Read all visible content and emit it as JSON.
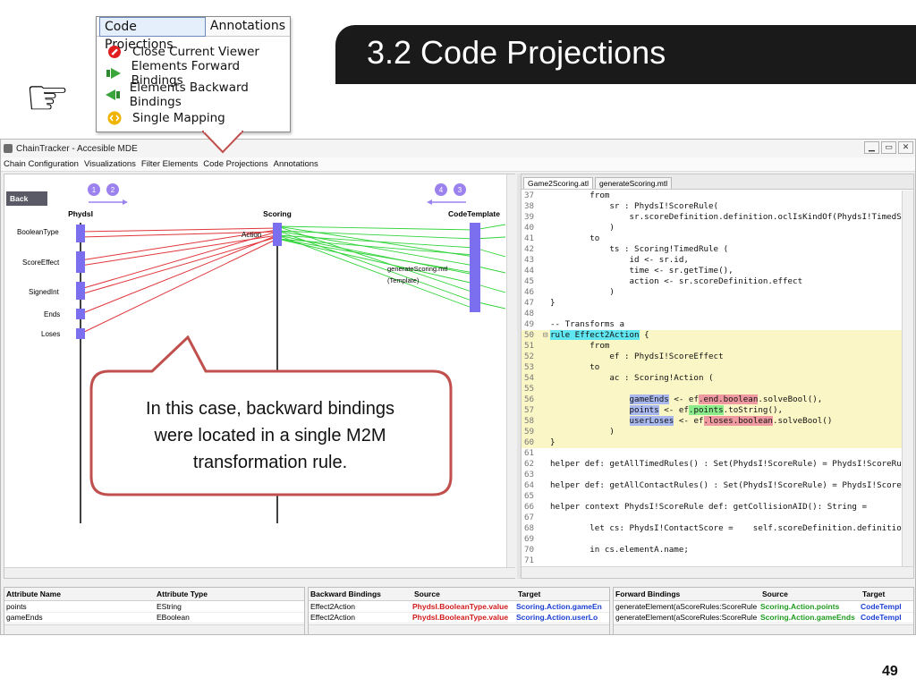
{
  "slide": {
    "title": "3.2 Code Projections",
    "page_number": "49",
    "hand_glyph": "☞"
  },
  "menu_popup": {
    "tabs": [
      "Code Projections",
      "Annotations"
    ],
    "items": [
      {
        "label": "Close Current Viewer",
        "icon": "stop-icon",
        "color": "#e02020"
      },
      {
        "label": "Elements Forward Bindings",
        "icon": "arrow-right-icon",
        "color": "#3aa53a"
      },
      {
        "label": "Elements Backward Bindings",
        "icon": "arrow-left-icon",
        "color": "#3aa53a"
      },
      {
        "label": "Single Mapping",
        "icon": "code-icon",
        "color": "#f0b400"
      }
    ]
  },
  "window": {
    "title": "ChainTracker - Accesible MDE",
    "controls": [
      "▁",
      "▭",
      "✕"
    ],
    "menu": [
      "Chain Configuration",
      "Visualizations",
      "Filter Elements",
      "Code Projections",
      "Annotations"
    ]
  },
  "viz": {
    "back_label": "Back",
    "badges_left": [
      "1",
      "2"
    ],
    "badges_right": [
      "4",
      "3"
    ],
    "columns": [
      "PhydsI",
      "Scoring",
      "CodeTemplate"
    ],
    "left_items": [
      "BooleanType",
      "ScoreEffect",
      "SignedInt",
      "Ends",
      "Loses"
    ],
    "mid_label": "Action",
    "template_label_1": "generateScoring.mtl",
    "template_label_2": "(Template)",
    "colors": {
      "backward": "#e0353a",
      "forward": "#31d43a",
      "node": "#7b6ff0",
      "badge": "#9b82ee"
    }
  },
  "callout": {
    "lines": [
      "In this case, backward bindings",
      "were located in a single M2M",
      "transformation rule."
    ],
    "border_color": "#c0504d"
  },
  "editor": {
    "tabs": [
      "Game2Scoring.atl",
      "generateScoring.mtl"
    ],
    "lines": [
      {
        "n": "37",
        "text": "        from"
      },
      {
        "n": "38",
        "text": "            sr : PhydsI!ScoreRule("
      },
      {
        "n": "39",
        "text": "                sr.scoreDefinition.definition.oclIsKindOf(PhydsI!TimedScore)"
      },
      {
        "n": "40",
        "text": "            )"
      },
      {
        "n": "41",
        "text": "        to"
      },
      {
        "n": "42",
        "text": "            ts : Scoring!TimedRule ("
      },
      {
        "n": "43",
        "text": "                id <- sr.id,"
      },
      {
        "n": "44",
        "text": "                time <- sr.getTime(),"
      },
      {
        "n": "45",
        "text": "                action <- sr.scoreDefinition.effect"
      },
      {
        "n": "46",
        "text": "            )"
      },
      {
        "n": "47",
        "text": "}"
      },
      {
        "n": "48",
        "text": ""
      },
      {
        "n": "49",
        "text": "-- Transforms a"
      },
      {
        "n": "50",
        "text": "rule Effect2Action {"
      },
      {
        "n": "51",
        "text": "        from"
      },
      {
        "n": "52",
        "text": "            ef : PhydsI!ScoreEffect"
      },
      {
        "n": "53",
        "text": "        to"
      },
      {
        "n": "54",
        "text": "            ac : Scoring!Action ("
      },
      {
        "n": "55",
        "text": ""
      },
      {
        "n": "56",
        "text": "                gameEnds <- ef.end.boolean.solveBool(),"
      },
      {
        "n": "57",
        "text": "                points <- ef.points.toString(),"
      },
      {
        "n": "58",
        "text": "                userLoses <- ef.loses.boolean.solveBool()"
      },
      {
        "n": "59",
        "text": "            )"
      },
      {
        "n": "60",
        "text": "}"
      },
      {
        "n": "61",
        "text": ""
      },
      {
        "n": "62",
        "text": "helper def: getAllTimedRules() : Set(PhydsI!ScoreRule) = PhydsI!ScoreRule.a"
      },
      {
        "n": "63",
        "text": ""
      },
      {
        "n": "64",
        "text": "helper def: getAllContactRules() : Set(PhydsI!ScoreRule) = PhydsI!ScoreRule"
      },
      {
        "n": "65",
        "text": ""
      },
      {
        "n": "66",
        "text": "helper context PhydsI!ScoreRule def: getCollisionAID(): String ="
      },
      {
        "n": "67",
        "text": ""
      },
      {
        "n": "68",
        "text": "        let cs: PhydsI!ContactScore =    self.scoreDefinition.definition -- Foo"
      },
      {
        "n": "69",
        "text": ""
      },
      {
        "n": "70",
        "text": "        in cs.elementA.name;"
      },
      {
        "n": "71",
        "text": ""
      }
    ]
  },
  "tables": {
    "attributes": {
      "headers": [
        "Attribute Name",
        "Attribute Type"
      ],
      "rows": [
        [
          "points",
          "EString"
        ],
        [
          "gameEnds",
          "EBoolean"
        ]
      ]
    },
    "backward": {
      "headers": [
        "Backward Bindings",
        "Source",
        "Target"
      ],
      "rows": [
        [
          "Effect2Action",
          "PhydsI.BooleanType.value",
          "Scoring.Action.gameEn"
        ],
        [
          "Effect2Action",
          "PhydsI.BooleanType.value",
          "Scoring.Action.userLo"
        ]
      ]
    },
    "forward": {
      "headers": [
        "Forward Bindings",
        "Source",
        "Target"
      ],
      "rows": [
        [
          "generateElement(aScoreRules:ScoreRules)",
          "Scoring.Action.points",
          "CodeTempl"
        ],
        [
          "generateElement(aScoreRules:ScoreRules)",
          "Scoring.Action.gameEnds",
          "CodeTempl"
        ]
      ]
    }
  }
}
